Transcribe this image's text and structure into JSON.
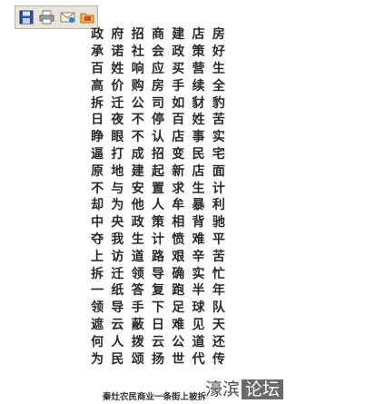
{
  "toolbar": {
    "buttons": [
      {
        "name": "save-icon"
      },
      {
        "name": "print-icon"
      },
      {
        "name": "email-icon"
      },
      {
        "name": "open-folder-icon"
      }
    ]
  },
  "poem": {
    "rows": [
      [
        "政",
        "府",
        "招",
        "商",
        "建",
        "店",
        "房"
      ],
      [
        "承",
        "诺",
        "社",
        "会",
        "政",
        "策",
        "好"
      ],
      [
        "百",
        "姓",
        "响",
        "应",
        "买",
        "营",
        "生"
      ],
      [
        "高",
        "价",
        "购",
        "房",
        "手",
        "续",
        "全"
      ],
      [
        "拆",
        "迁",
        "公",
        "司",
        "如",
        "豺",
        "豹"
      ],
      [
        "日",
        "夜",
        "不",
        "停",
        "百",
        "姓",
        "苦"
      ],
      [
        "睁",
        "眼",
        "不",
        "认",
        "店",
        "事",
        "实"
      ],
      [
        "逼",
        "打",
        "成",
        "招",
        "变",
        "民",
        "宅"
      ],
      [
        "原",
        "地",
        "建",
        "起",
        "新",
        "店",
        "面"
      ],
      [
        "不",
        "与",
        "安",
        "置",
        "求",
        "生",
        "计"
      ],
      [
        "却",
        "为",
        "他",
        "人",
        "牟",
        "暴",
        "利"
      ],
      [
        "中",
        "央",
        "政",
        "策",
        "相",
        "背",
        "驰"
      ],
      [
        "夺",
        "我",
        "生",
        "计",
        "愤",
        "难",
        "平"
      ],
      [
        "上",
        "访",
        "道",
        "路",
        "艰",
        "辛",
        "苦"
      ],
      [
        "拆",
        "迁",
        "领",
        "导",
        "确",
        "实",
        "忙"
      ],
      [
        "一",
        "纸",
        "答",
        "复",
        "跑",
        "半",
        "年"
      ],
      [
        "领",
        "导",
        "手",
        "下",
        "足",
        "球",
        "队"
      ],
      [
        "遮",
        "云",
        "蔽",
        "日",
        "难",
        "见",
        "天"
      ],
      [
        "何",
        "人",
        "拨",
        "云",
        "公",
        "道",
        "还"
      ],
      [
        "为",
        "民",
        "颂",
        "扬",
        "世",
        "代",
        "传"
      ]
    ]
  },
  "caption": "秦灶农民商业一条街上被拆",
  "watermark": {
    "left": "濠滨",
    "right": "论坛"
  }
}
